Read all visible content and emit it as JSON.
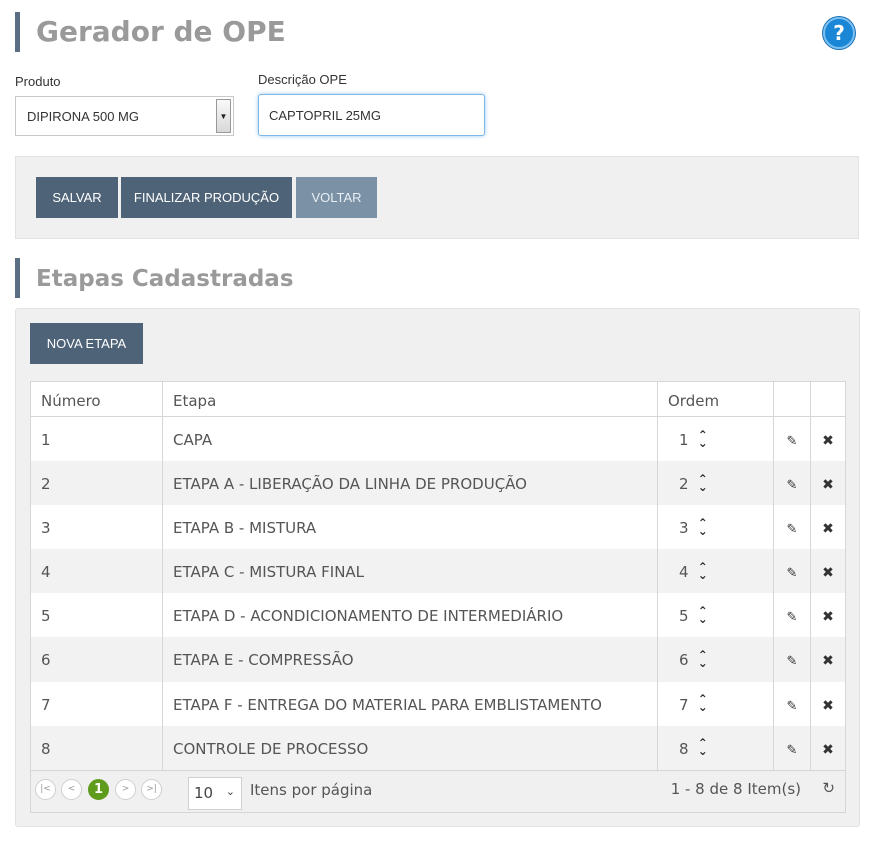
{
  "header": {
    "title": "Gerador de OPE",
    "help_icon": "question-circle-icon"
  },
  "form": {
    "produto_label": "Produto",
    "produto_value": "DIPIRONA 500 MG",
    "descricao_label": "Descrição OPE",
    "descricao_value": "CAPTOPRIL 25MG"
  },
  "toolbar": {
    "salvar_label": "SALVAR",
    "finalizar_label": "FINALIZAR PRODUÇÃO",
    "voltar_label": "VOLTAR"
  },
  "etapas": {
    "title": "Etapas Cadastradas",
    "nova_label": "NOVA ETAPA",
    "columns": {
      "numero": "Número",
      "etapa": "Etapa",
      "ordem": "Ordem"
    },
    "rows": [
      {
        "numero": "1",
        "etapa": "CAPA",
        "ordem": "1"
      },
      {
        "numero": "2",
        "etapa": "ETAPA A - LIBERAÇÃO DA LINHA DE PRODUÇÃO",
        "ordem": "2"
      },
      {
        "numero": "3",
        "etapa": "ETAPA B - MISTURA",
        "ordem": "3"
      },
      {
        "numero": "4",
        "etapa": "ETAPA C - MISTURA FINAL",
        "ordem": "4"
      },
      {
        "numero": "5",
        "etapa": "ETAPA D - ACONDICIONAMENTO DE INTERMEDIÁRIO",
        "ordem": "5"
      },
      {
        "numero": "6",
        "etapa": "ETAPA E - COMPRESSÃO",
        "ordem": "6"
      },
      {
        "numero": "7",
        "etapa": "ETAPA F - ENTREGA DO MATERIAL PARA EMBLISTAMENTO",
        "ordem": "7"
      },
      {
        "numero": "8",
        "etapa": "CONTROLE DE PROCESSO",
        "ordem": "8"
      }
    ]
  },
  "pager": {
    "current_page": "1",
    "page_size": "10",
    "page_size_label": "Itens por página",
    "info": "1 - 8 de 8 Item(s)"
  },
  "colors": {
    "button": "#4e6378",
    "button_disabled": "#7a91a6",
    "accent_bar": "#5a6e84",
    "help": "#1a86d6",
    "pager_current": "#5f9b1c"
  }
}
